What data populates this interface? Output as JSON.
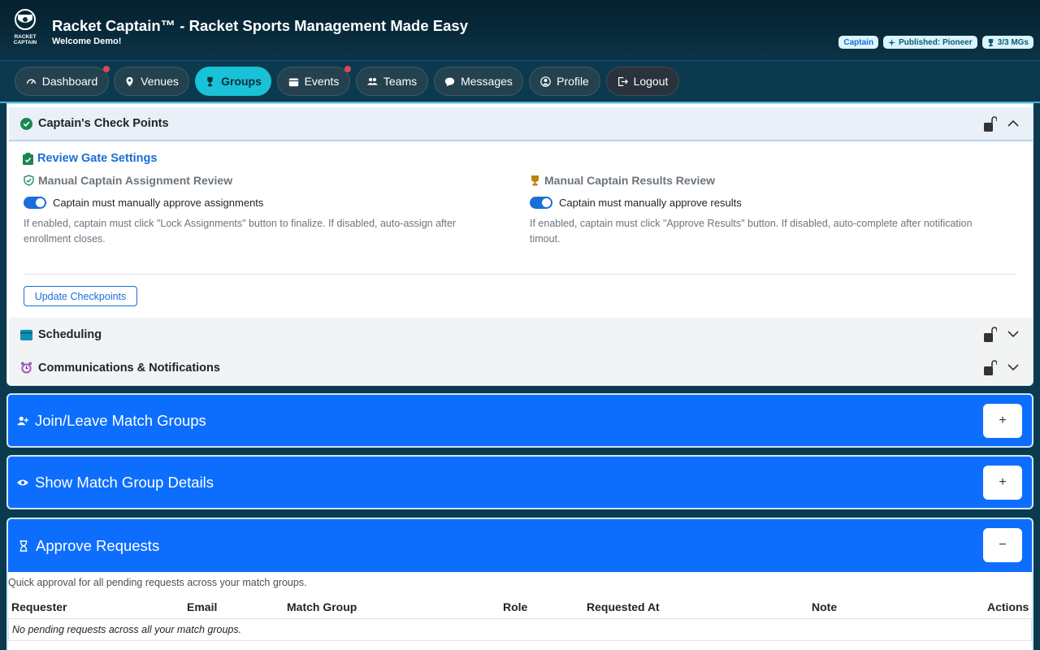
{
  "header": {
    "logo_text": "RACKET CAPTAIN",
    "title": "Racket Captain™ - Racket Sports Management Made Easy",
    "welcome": "Welcome Demo!",
    "badges": [
      {
        "label": "Captain",
        "icon": ""
      },
      {
        "label": "Published: Pioneer",
        "icon": "sparkle-icon"
      },
      {
        "label": "3/3 MGs",
        "icon": "trophy-icon"
      }
    ]
  },
  "nav": {
    "items": [
      {
        "label": "Dashboard",
        "icon": "dashboard-icon",
        "notification": true
      },
      {
        "label": "Venues",
        "icon": "map-pin-icon",
        "notification": false
      },
      {
        "label": "Groups",
        "icon": "trophy-icon",
        "active": true
      },
      {
        "label": "Events",
        "icon": "calendar-icon",
        "notification": true
      },
      {
        "label": "Teams",
        "icon": "people-icon"
      },
      {
        "label": "Messages",
        "icon": "chat-icon"
      },
      {
        "label": "Profile",
        "icon": "person-circle-icon"
      },
      {
        "label": "Logout",
        "icon": "logout-icon"
      }
    ]
  },
  "checkpoints": {
    "title": "Captain's Check Points",
    "review_gate_title": "Review Gate Settings",
    "assignment": {
      "heading": "Manual Captain Assignment Review",
      "toggle_label": "Captain must manually approve assignments",
      "toggle_on": true,
      "help": "If enabled, captain must click \"Lock Assignments\" button to finalize. If disabled, auto-assign after enrollment closes."
    },
    "results": {
      "heading": "Manual Captain Results Review",
      "toggle_label": "Captain must manually approve results",
      "toggle_on": true,
      "help": "If enabled, captain must click \"Approve Results\" button. If disabled, auto-complete after notification timout."
    },
    "update_button": "Update Checkpoints",
    "scheduling": "Scheduling",
    "communications": "Communications & Notifications"
  },
  "sections": {
    "join_leave": {
      "title": "Join/Leave Match Groups",
      "toggle": "+"
    },
    "details": {
      "title": "Show Match Group Details",
      "toggle": "+"
    },
    "approve": {
      "title": "Approve Requests",
      "toggle": "−"
    }
  },
  "approve_requests": {
    "description": "Quick approval for all pending requests across your match groups.",
    "columns": [
      "Requester",
      "Email",
      "Match Group",
      "Role",
      "Requested At",
      "Note",
      "Actions"
    ],
    "empty_message": "No pending requests across all your match groups."
  },
  "colors": {
    "primary": "#0d6efd",
    "accent": "#19c2d6",
    "header_bg": "#05202d",
    "notification": "#e0455c"
  }
}
